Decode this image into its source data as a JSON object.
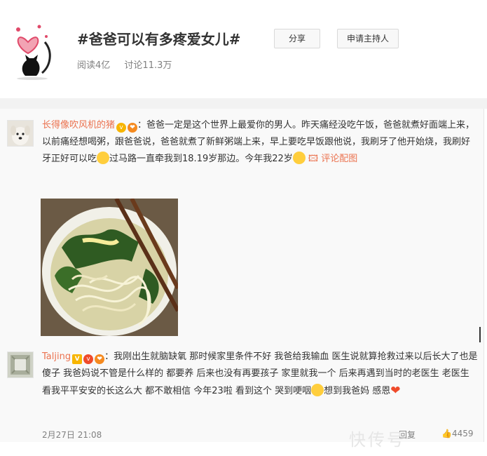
{
  "topic": {
    "title": "#爸爸可以有多疼爱女儿#",
    "share_label": "分享",
    "apply_host_label": "申请主持人",
    "reads": "阅读4亿",
    "discussions": "讨论11.3万"
  },
  "comments": [
    {
      "username": "长得像吹风机的猪",
      "text_a": "：爸爸一定是这个世界上最爱你的男人。昨天痛经没吃午饭，爸爸就煮好面端上来，以前痛经想喝粥，跟爸爸说，爸爸就煮了新鲜粥端上来，早上要吃早饭跟他说，我刷牙了他开始烧，我刷好牙正好可以吃",
      "text_b": "过马路一直牵我到18.19岁那边。今年我22岁",
      "link_label": "评论配图"
    },
    {
      "username": "Taljing",
      "text_a": "：我刚出生就脑缺氧 那时候家里条件不好 我爸给我输血 医生说就算抢救过来以后长大了也是傻子 我爸妈说不管是什么样的 都要养 后来也没有再要孩子 家里就我一个 后来再遇到当时的老医生 老医生看我平平安安的长这么大 都不敢相信 今年23啦 看到这个 哭到哽咽",
      "text_b": "想到我爸妈 感恩",
      "time": "2月27日 21:08",
      "reply_label": "回复",
      "likes": "4459"
    }
  ],
  "watermark": "快传号"
}
